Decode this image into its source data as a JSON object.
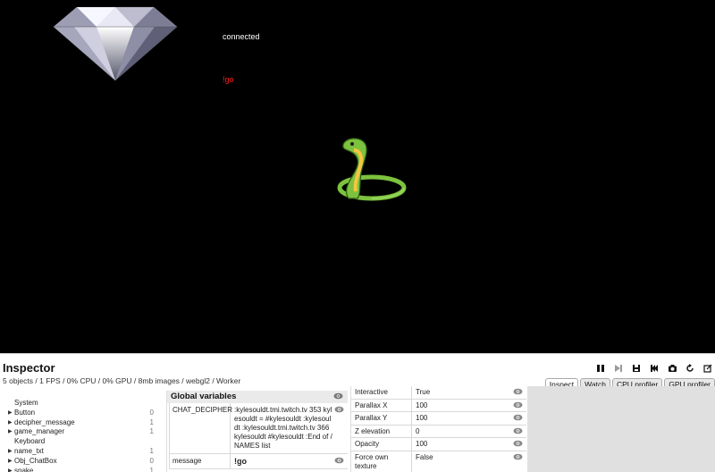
{
  "game": {
    "status_text": "connected",
    "chat_text": "!go"
  },
  "inspector": {
    "title": "Inspector",
    "stats": "5 objects / 1 FPS / 0% CPU / 0% GPU / 8mb images / webgl2 / Worker",
    "toolbar": [
      "pause-icon",
      "step-icon",
      "save-icon",
      "restart-icon",
      "screenshot-icon",
      "reload-icon",
      "expand-icon"
    ],
    "tabs": [
      "Inspect",
      "Watch",
      "CPU profiler",
      "GPU profiler"
    ],
    "active_tab": "Inspect"
  },
  "tree": {
    "system_label": "System",
    "items": [
      {
        "label": "Button",
        "count": "0"
      },
      {
        "label": "decipher_message",
        "count": "1"
      },
      {
        "label": "game_manager",
        "count": "1"
      }
    ],
    "keyboard_label": "Keyboard",
    "items2": [
      {
        "label": "name_txt",
        "count": "1"
      },
      {
        "label": "Obj_ChatBox",
        "count": "0"
      },
      {
        "label": "snake",
        "count": "1"
      }
    ]
  },
  "globals": {
    "header": "Global variables",
    "rows": [
      {
        "key": "CHAT_DECIPHER",
        "value": ":kylesouldt.tmi.twitch.tv 353 kylesouldt = #kylesouldt :kylesouldt :kylesouldt.tmi.twitch.tv 366 kylesouldt #kylesouldt :End of /NAMES list"
      },
      {
        "key": "message",
        "value": "!go"
      }
    ]
  },
  "properties": {
    "rows": [
      {
        "key": "Interactive",
        "value": "True"
      },
      {
        "key": "Parallax X",
        "value": "100"
      },
      {
        "key": "Parallax Y",
        "value": "100"
      },
      {
        "key": "Z elevation",
        "value": "0"
      },
      {
        "key": "Opacity",
        "value": "100"
      },
      {
        "key": "Force own texture",
        "value": "False"
      }
    ]
  },
  "colors": {
    "chat_text": "#ff2020",
    "snake_green": "#7cc23e",
    "snake_yellow": "#f5c542"
  }
}
